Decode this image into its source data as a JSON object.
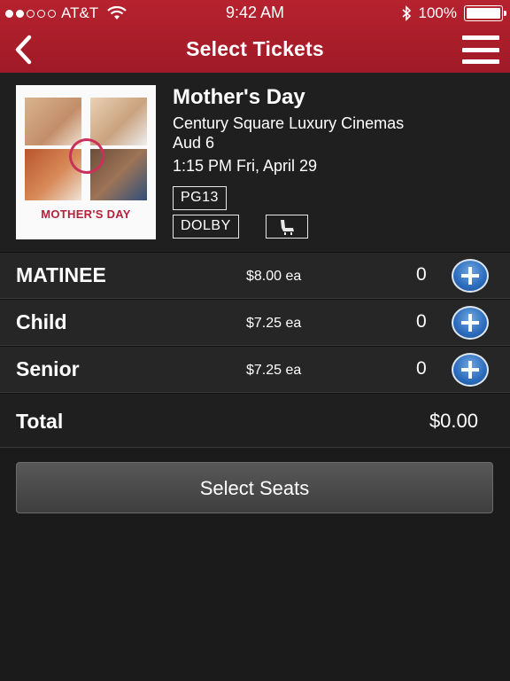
{
  "status_bar": {
    "carrier": "AT&T",
    "time": "9:42 AM",
    "battery": "100%",
    "signal_bars": 2
  },
  "nav": {
    "title": "Select Tickets",
    "back_icon": "chevron-left-icon",
    "menu_icon": "hamburger-menu-icon"
  },
  "movie": {
    "poster_title": "MOTHER'S DAY",
    "title": "Mother's Day",
    "theater": "Century Square Luxury Cinemas",
    "auditorium": "Aud 6",
    "showtime": "1:15 PM Fri, April 29",
    "rating": "PG13",
    "format": "DOLBY",
    "seat_icon": "recliner-seat-icon"
  },
  "tickets": [
    {
      "name": "MATINEE",
      "price": "$8.00 ea",
      "qty": "0"
    },
    {
      "name": "Child",
      "price": "$7.25 ea",
      "qty": "0"
    },
    {
      "name": "Senior",
      "price": "$7.25 ea",
      "qty": "0"
    }
  ],
  "total": {
    "label": "Total",
    "value": "$0.00"
  },
  "actions": {
    "select_seats": "Select Seats"
  },
  "colors": {
    "header": "#b7222f",
    "background": "#1b1b1b",
    "plus_button": "#2c6cbd"
  }
}
